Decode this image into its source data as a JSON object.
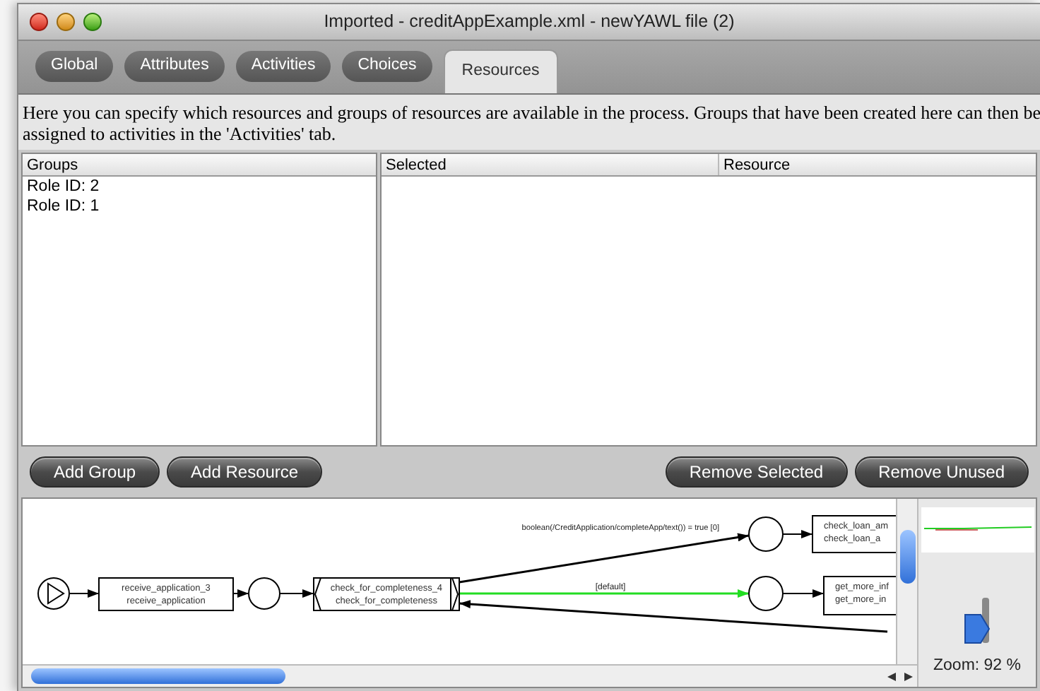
{
  "window": {
    "title": "Imported - creditAppExample.xml - newYAWL file (2)"
  },
  "tabs": [
    {
      "label": "Global",
      "selected": false
    },
    {
      "label": "Attributes",
      "selected": false
    },
    {
      "label": "Activities",
      "selected": false
    },
    {
      "label": "Choices",
      "selected": false
    },
    {
      "label": "Resources",
      "selected": true
    }
  ],
  "description": "Here you can specify which resources and groups of resources are available in the process. Groups that have been created here can then be assigned to activities in the 'Activities' tab.",
  "groups_table": {
    "column": "Groups",
    "rows": [
      "Role ID: 2",
      "Role ID: 1"
    ]
  },
  "resources_table": {
    "columns": [
      "Selected",
      "Resource"
    ]
  },
  "buttons_left": [
    "Add Group",
    "Add Resource"
  ],
  "buttons_right": [
    "Remove Selected",
    "Remove Unused"
  ],
  "diagram": {
    "tasks": [
      {
        "lines": [
          "receive_application_3",
          "receive_application"
        ]
      },
      {
        "lines": [
          "check_for_completeness_4",
          "check_for_completeness"
        ]
      },
      {
        "lines": [
          "check_loan_am",
          "check_loan_a"
        ]
      },
      {
        "lines": [
          "get_more_inf",
          "get_more_in"
        ]
      }
    ],
    "flow_labels": [
      "boolean(/CreditApplication/completeApp/text()) = true [0]",
      "[default]"
    ]
  },
  "zoom": "Zoom: 92 %"
}
